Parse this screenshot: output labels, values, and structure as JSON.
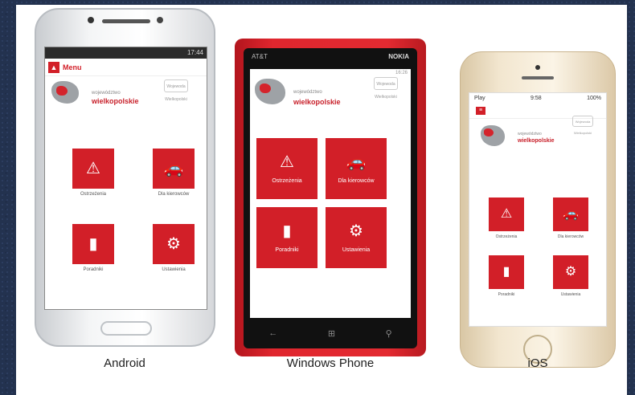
{
  "captions": [
    "Android",
    "Windows Phone",
    "iOS"
  ],
  "android": {
    "status": "17:44",
    "appbar_title": "Menu",
    "region_small": "województwo",
    "region_name": "wielkopolskie",
    "emblem": "Wojewoda Wielkopolski",
    "tiles": [
      {
        "icon": "warning-icon",
        "glyph": "⚠",
        "label": "Ostrzeżenia"
      },
      {
        "icon": "car-icon",
        "glyph": "🚗",
        "label": "Dla kierowców"
      },
      {
        "icon": "book-icon",
        "glyph": "▮",
        "label": "Poradniki"
      },
      {
        "icon": "gear-icon",
        "glyph": "⚙",
        "label": "Ustawienia"
      }
    ]
  },
  "windows_phone": {
    "brand": "NOKIA",
    "carrier": "AT&T",
    "time": "16:26",
    "region_small": "województwo",
    "region_name": "wielkopolskie",
    "emblem": "Wojewoda Wielkopolski",
    "tiles": [
      {
        "icon": "warning-icon",
        "glyph": "⚠",
        "label": "Ostrzeżenia"
      },
      {
        "icon": "car-icon",
        "glyph": "🚗",
        "label": "Dla kierowców"
      },
      {
        "icon": "book-icon",
        "glyph": "▮",
        "label": "Poradniki"
      },
      {
        "icon": "gear-icon",
        "glyph": "⚙",
        "label": "Ustawienia"
      }
    ]
  },
  "ios": {
    "carrier": "Play",
    "time": "9:58",
    "battery": "100%",
    "region_small": "województwo",
    "region_name": "wielkopolskie",
    "emblem": "Wojewoda Wielkopolski",
    "tiles": [
      {
        "icon": "warning-icon",
        "glyph": "⚠",
        "label": "Ostrzeżenia"
      },
      {
        "icon": "car-icon",
        "glyph": "🚗",
        "label": "Dla kierowców"
      },
      {
        "icon": "book-icon",
        "glyph": "▮",
        "label": "Poradniki"
      },
      {
        "icon": "gear-icon",
        "glyph": "⚙",
        "label": "Ustawienia"
      }
    ]
  },
  "colors": {
    "accent": "#d21f28",
    "wp_body": "#e32a31"
  }
}
